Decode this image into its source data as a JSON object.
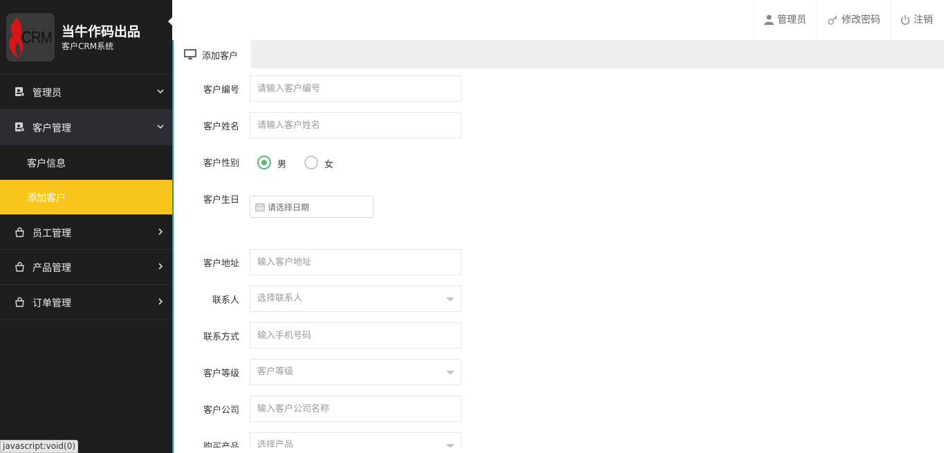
{
  "brand": {
    "logo_text": "CRM",
    "title": "当牛作码出品",
    "subtitle": "客户CRM系统"
  },
  "sidebar": {
    "items": [
      {
        "label": "管理员",
        "expanded": false
      },
      {
        "label": "客户管理",
        "expanded": true,
        "children": [
          {
            "label": "客户信息",
            "active": false
          },
          {
            "label": "添加客户",
            "active": true
          }
        ]
      },
      {
        "label": "员工管理",
        "expanded": false
      },
      {
        "label": "产品管理",
        "expanded": false
      },
      {
        "label": "订单管理",
        "expanded": false
      }
    ],
    "status_tip": "javascript:void(0)"
  },
  "topbar": {
    "admin": "管理员",
    "change_password": "修改密码",
    "logout": "注销"
  },
  "tab": {
    "label": "添加客户"
  },
  "form": {
    "code": {
      "label": "客户编号",
      "placeholder": "请输入客户编号"
    },
    "name": {
      "label": "客户姓名",
      "placeholder": "请输入客户姓名"
    },
    "gender": {
      "label": "客户性别",
      "options": [
        "男",
        "女"
      ],
      "selected": "男"
    },
    "birthday": {
      "label": "客户生日",
      "placeholder": "请选择日期"
    },
    "address": {
      "label": "客户地址",
      "placeholder": "输入客户地址"
    },
    "contact": {
      "label": "联系人",
      "value": "选择联系人"
    },
    "phone": {
      "label": "联系方式",
      "placeholder": "输入手机号码"
    },
    "level": {
      "label": "客户等级",
      "value": "客户等级"
    },
    "company": {
      "label": "客户公司",
      "placeholder": "输入客户公司名称"
    },
    "product": {
      "label": "购买产品",
      "value": "选择产品"
    }
  },
  "colors": {
    "sidebar_bg": "#1e1e1e",
    "active_item": "#f8c51c",
    "accent_line": "#16a086",
    "radio_on": "#5fb878"
  }
}
